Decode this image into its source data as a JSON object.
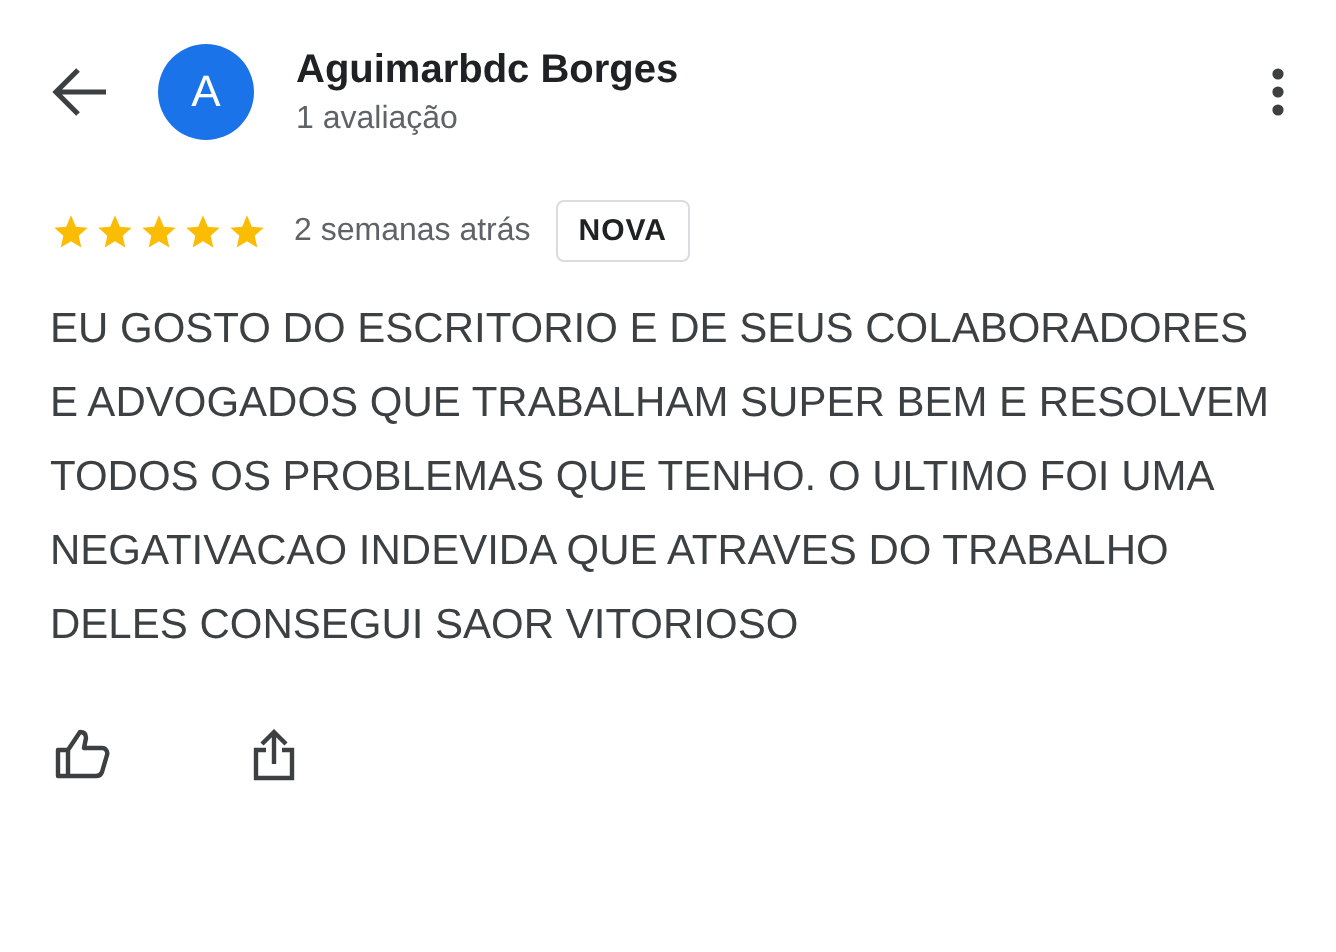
{
  "reviewer": {
    "initial": "A",
    "name": "Aguimarbdc Borges",
    "review_count": "1 avaliação"
  },
  "review": {
    "stars": 5,
    "time": "2 semanas atrás",
    "badge": "NOVA",
    "text": "EU GOSTO DO ESCRITORIO E DE SEUS COLABORADORES E ADVOGADOS QUE TRABALHAM SUPER BEM E RESOLVEM TODOS OS PROBLEMAS QUE TENHO. O ULTIMO FOI UMA NEGATIVACAO INDEVIDA QUE ATRAVES DO TRABALHO DELES CONSEGUI SAOR VITORIOSO"
  }
}
